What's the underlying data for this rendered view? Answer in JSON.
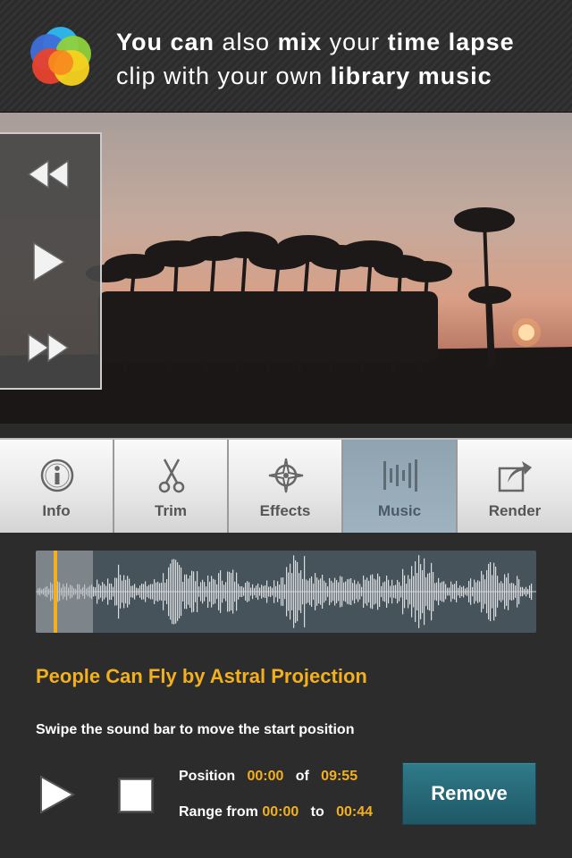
{
  "header": {
    "headline_parts": [
      {
        "text": "You can",
        "bold": true
      },
      {
        "text": " also ",
        "bold": false
      },
      {
        "text": "mix",
        "bold": true
      },
      {
        "text": " your ",
        "bold": false
      },
      {
        "text": "time lapse",
        "bold": true
      },
      {
        "text": "clip with your own ",
        "bold": false,
        "newline": true
      },
      {
        "text": "library music",
        "bold": true
      }
    ],
    "logo_icon": "app-logo-icon"
  },
  "transport": {
    "rewind_icon": "rewind-icon",
    "play_icon": "play-icon",
    "forward_icon": "fast-forward-icon"
  },
  "tabs": [
    {
      "label": "Info",
      "icon": "info-icon",
      "active": false
    },
    {
      "label": "Trim",
      "icon": "scissors-icon",
      "active": false
    },
    {
      "label": "Effects",
      "icon": "effects-icon",
      "active": false
    },
    {
      "label": "Music",
      "icon": "music-waveform-icon",
      "active": true
    },
    {
      "label": "Render",
      "icon": "share-icon",
      "active": false
    }
  ],
  "music": {
    "song_title": "People Can Fly by Astral Projection",
    "hint": "Swipe the sound bar to move the start position",
    "position_label": "Position",
    "position_value": "00:00",
    "of_label": "of",
    "duration_value": "09:55",
    "range_label": "Range from",
    "range_start": "00:00",
    "to_label": "to",
    "range_end": "00:44",
    "remove_label": "Remove"
  },
  "colors": {
    "accent": "#f2b01e",
    "remove_button": "#2f7a8a",
    "active_tab": "#9fb2bf"
  }
}
